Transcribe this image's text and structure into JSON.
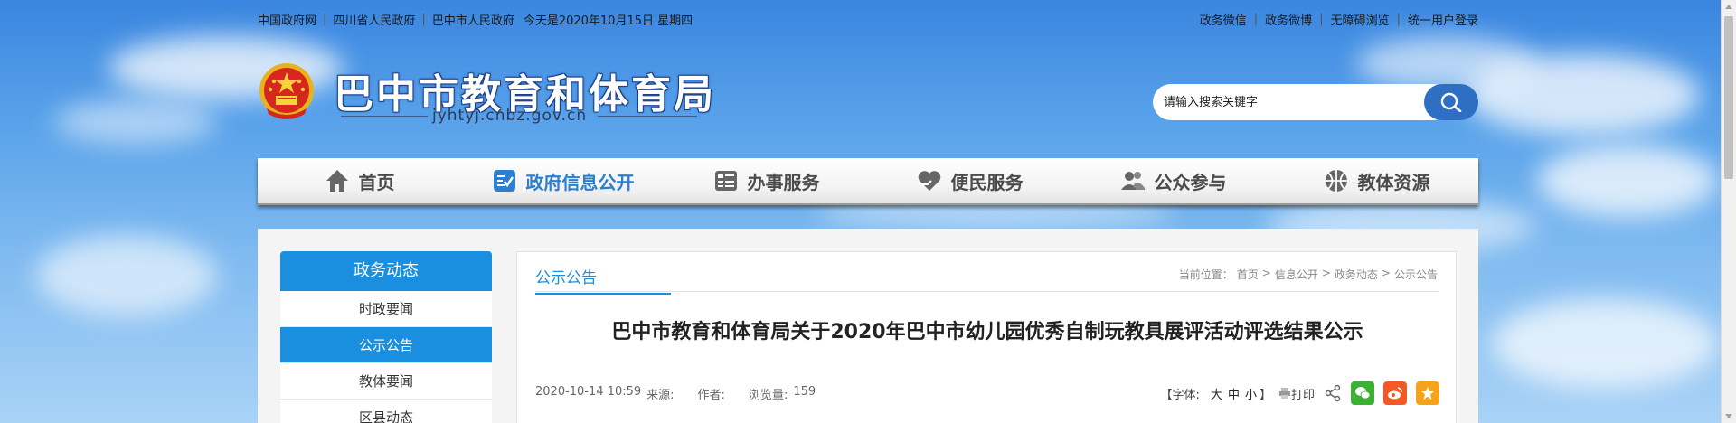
{
  "topbar": {
    "links_left": [
      "中国政府网",
      "四川省人民政府",
      "巴中市人民政府"
    ],
    "date_text": "今天是2020年10月15日 星期四",
    "links_right": [
      "政务微信",
      "政务微博",
      "无障碍浏览",
      "统一用户登录"
    ],
    "separator": "|"
  },
  "header": {
    "site_title": "巴中市教育和体育局",
    "domain": "jyhtyj.cnbz.gov.cn"
  },
  "search": {
    "placeholder": "请输入搜索关键字",
    "icon": "search-icon"
  },
  "nav": {
    "items": [
      {
        "label": "首页",
        "icon": "home-icon"
      },
      {
        "label": "政府信息公开",
        "icon": "info-public-icon",
        "active": true
      },
      {
        "label": "办事服务",
        "icon": "service-icon"
      },
      {
        "label": "便民服务",
        "icon": "heart-hand-icon"
      },
      {
        "label": "公众参与",
        "icon": "people-icon"
      },
      {
        "label": "教体资源",
        "icon": "ball-icon"
      }
    ]
  },
  "sidebar": {
    "heading": "政务动态",
    "items": [
      {
        "label": "时政要闻"
      },
      {
        "label": "公示公告",
        "active": true
      },
      {
        "label": "教体要闻"
      },
      {
        "label": "区县动态"
      }
    ]
  },
  "article": {
    "section_tab": "公示公告",
    "breadcrumb": {
      "prefix": "当前位置：",
      "items": [
        "首页",
        "信息公开",
        "政务动态",
        "公示公告"
      ],
      "separator": ">"
    },
    "title": "巴中市教育和体育局关于2020年巴中市幼儿园优秀自制玩教具展评活动评选结果公示",
    "meta": {
      "datetime": "2020-10-14 10:59",
      "source_label": "来源:",
      "author_label": "作者:",
      "views_label": "浏览量:",
      "views": "159"
    },
    "tools": {
      "font_label_open": "【字体:",
      "font_large": "大",
      "font_medium": "中",
      "font_small": "小",
      "font_label_close": "】",
      "print_label": "打印"
    }
  },
  "colors": {
    "accent": "#1a8fe0",
    "nav_active": "#2a7fd0",
    "search_button": "#2e6fc4",
    "wechat": "#3cb034",
    "weibo": "#f15a24",
    "favorite": "#f7a21b"
  }
}
